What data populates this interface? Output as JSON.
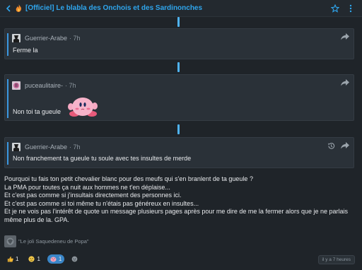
{
  "topbar": {
    "title": "[Officiel] Le blabla des Onchois et des Sardinonches",
    "back_icon": "chevron-left-icon",
    "flame_icon": "flame-icon",
    "star_icon": "star-icon",
    "menu_icon": "more-vertical-icon"
  },
  "quotes": [
    {
      "author": "Guerrier-Arabe",
      "time": "· 7h",
      "text": "Ferme la"
    },
    {
      "author": "puceaulitaire-",
      "time": "· 7h",
      "text": "Non toi ta gueule"
    },
    {
      "author": "Guerrier-Arabe",
      "time": "· 7h",
      "text": "Non franchement ta gueule tu soule avec tes insultes de merde"
    }
  ],
  "body": {
    "lines": [
      "Pourquoi tu fais ton petit chevalier blanc pour des meufs qui s'en branlent de ta gueule ?",
      "La PMA pour toutes ça nuit aux hommes ne t'en déplaise...",
      "Et c'est pas comme si j'insultais directement des personnes ici.",
      "Et c'est pas comme si toi même tu n'étais pas généreux en insultes...",
      "Et je ne vois pas l'intérêt de quote un message plusieurs pages après pour me dire de me la fermer alors que je ne parlais",
      "même plus de la. GPA."
    ]
  },
  "signature": {
    "text": "\"Le joli Saquedeneu de Popa\""
  },
  "reactions": [
    {
      "icon": "thumbs-up-emoji",
      "count": "1"
    },
    {
      "icon": "neutral-face-emoji",
      "count": "1"
    },
    {
      "icon": "pig-emoji",
      "count": "1"
    },
    {
      "icon": "add-reaction-icon",
      "count": ""
    }
  ],
  "post_time": "il y a 7 heures",
  "colors": {
    "accent": "#2fa6ee",
    "background": "#1f2429",
    "card": "#2a3138",
    "active_reaction": "#3a86c8"
  }
}
